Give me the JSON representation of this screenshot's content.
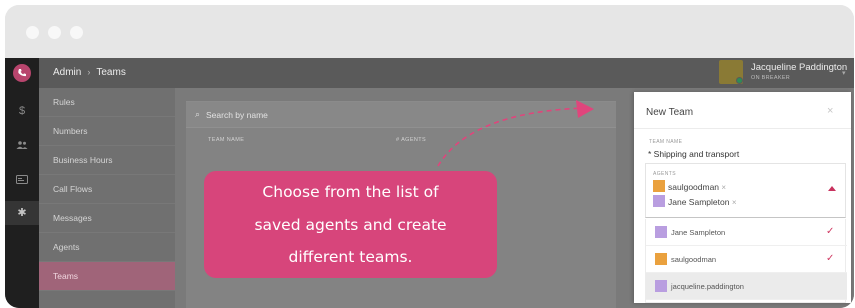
{
  "breadcrumb": {
    "section": "Admin",
    "page": "Teams"
  },
  "user": {
    "name": "Jacqueline Paddington",
    "status": "ON BREAKER"
  },
  "sidebar": {
    "items": [
      {
        "label": "Rules"
      },
      {
        "label": "Numbers"
      },
      {
        "label": "Business Hours"
      },
      {
        "label": "Call Flows"
      },
      {
        "label": "Messages"
      },
      {
        "label": "Agents"
      },
      {
        "label": "Teams",
        "active": true
      }
    ]
  },
  "teams_list": {
    "search_placeholder": "Search by name",
    "columns": [
      "TEAM NAME",
      "# AGENTS"
    ]
  },
  "new_team": {
    "title": "New Team",
    "name_label": "TEAM NAME",
    "name_value": "* Shipping and transport",
    "agents_label": "AGENTS",
    "selected_agents": [
      {
        "name": "saulgoodman",
        "initial": "S",
        "color": "orange"
      },
      {
        "name": "Jane Sampleton",
        "initial": "J",
        "color": "purple"
      }
    ],
    "options": [
      {
        "name": "Jane Sampleton",
        "initial": "J",
        "color": "purple",
        "checked": true
      },
      {
        "name": "saulgoodman",
        "initial": "S",
        "color": "orange",
        "checked": true
      },
      {
        "name": "jacqueline.paddington",
        "initial": "J",
        "color": "purple",
        "checked": false
      }
    ]
  },
  "callout": {
    "lines": [
      "Choose from the list of",
      "saved agents and create",
      "different teams."
    ]
  },
  "colors": {
    "accent": "#d7457b",
    "rail": "#1f1f1f",
    "check": "#d03a63"
  }
}
